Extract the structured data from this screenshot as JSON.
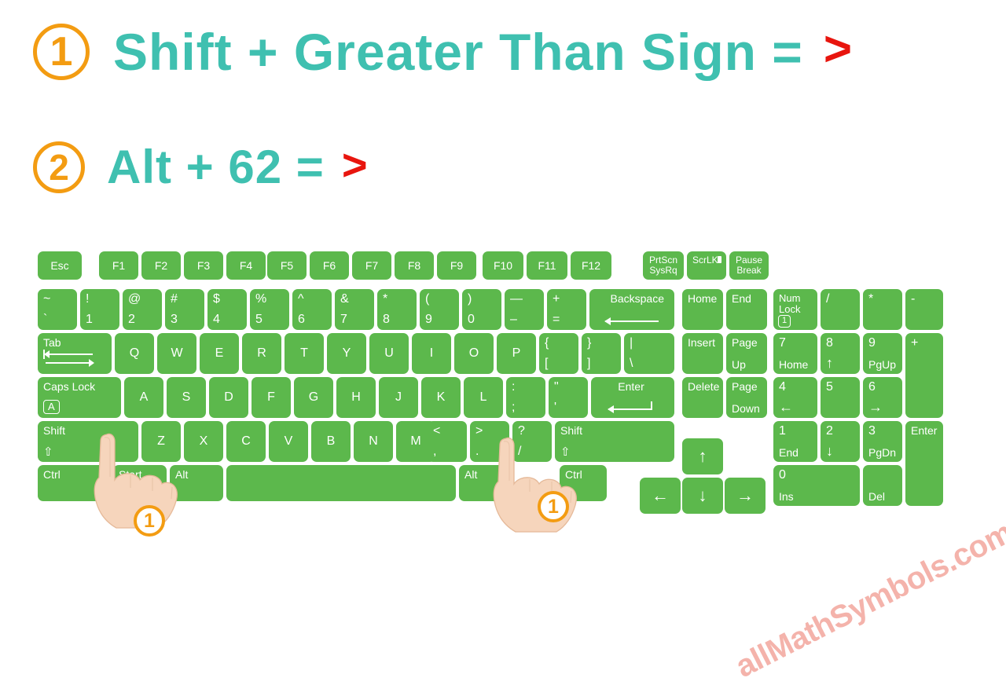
{
  "page": {
    "background": "#ffffff",
    "accent_teal": "#3fc0b0",
    "accent_orange": "#f39c12",
    "accent_red": "#e8150e",
    "key_green": "#5cb84c",
    "watermark_color": "#f4b3ab"
  },
  "instructions": [
    {
      "number": "1",
      "text": "Shift  +  Greater Than Sign  =",
      "result": ">"
    },
    {
      "number": "2",
      "text": "Alt  +  62  =",
      "result": ">"
    }
  ],
  "watermark": {
    "text": "allMathSymbols.com"
  },
  "markers": [
    {
      "label": "1",
      "target": "left-shift"
    },
    {
      "label": "1",
      "target": "greater-than-key"
    }
  ],
  "keyboard": {
    "function_row": [
      {
        "label": "Esc"
      },
      {
        "label": "F1"
      },
      {
        "label": "F2"
      },
      {
        "label": "F3"
      },
      {
        "label": "F4"
      },
      {
        "label": "F5"
      },
      {
        "label": "F6"
      },
      {
        "label": "F7"
      },
      {
        "label": "F8"
      },
      {
        "label": "F9"
      },
      {
        "label": "F10"
      },
      {
        "label": "F11"
      },
      {
        "label": "F12"
      }
    ],
    "function_row_right": [
      {
        "top": "PrtScn",
        "bottom": "SysRq"
      },
      {
        "top": "ScrLK",
        "bottom": ""
      },
      {
        "top": "Pause",
        "bottom": "Break"
      }
    ],
    "number_row": [
      {
        "top": "~",
        "bottom": "`"
      },
      {
        "top": "!",
        "bottom": "1"
      },
      {
        "top": "@",
        "bottom": "2"
      },
      {
        "top": "#",
        "bottom": "3"
      },
      {
        "top": "$",
        "bottom": "4"
      },
      {
        "top": "%",
        "bottom": "5"
      },
      {
        "top": "^",
        "bottom": "6"
      },
      {
        "top": "&",
        "bottom": "7"
      },
      {
        "top": "*",
        "bottom": "8"
      },
      {
        "top": "(",
        "bottom": "9"
      },
      {
        "top": ")",
        "bottom": "0"
      },
      {
        "top": "—",
        "bottom": "–"
      },
      {
        "top": "+",
        "bottom": "="
      }
    ],
    "backspace": {
      "label": "Backspace"
    },
    "tab": {
      "label": "Tab"
    },
    "qwerty_row": [
      {
        "label": "Q"
      },
      {
        "label": "W"
      },
      {
        "label": "E"
      },
      {
        "label": "R"
      },
      {
        "label": "T"
      },
      {
        "label": "Y"
      },
      {
        "label": "U"
      },
      {
        "label": "I"
      },
      {
        "label": "O"
      },
      {
        "label": "P"
      }
    ],
    "qwerty_row_symbols": [
      {
        "top": "{",
        "bottom": "["
      },
      {
        "top": "}",
        "bottom": "]"
      },
      {
        "top": "|",
        "bottom": "\\"
      }
    ],
    "caps_lock": {
      "label": "Caps Lock",
      "indicator": "A"
    },
    "home_row": [
      {
        "label": "A"
      },
      {
        "label": "S"
      },
      {
        "label": "D"
      },
      {
        "label": "F"
      },
      {
        "label": "G"
      },
      {
        "label": "H"
      },
      {
        "label": "J"
      },
      {
        "label": "K"
      },
      {
        "label": "L"
      }
    ],
    "home_row_symbols": [
      {
        "top": ":",
        "bottom": ";"
      },
      {
        "top": "\"",
        "bottom": "'"
      }
    ],
    "enter": {
      "label": "Enter"
    },
    "left_shift": {
      "label": "Shift",
      "glyph": "⇧"
    },
    "bottom_row_letters": [
      {
        "label": "Z"
      },
      {
        "label": "X"
      },
      {
        "label": "C"
      },
      {
        "label": "V"
      },
      {
        "label": "B"
      },
      {
        "label": "N"
      },
      {
        "label": "M"
      }
    ],
    "bottom_row_symbols": [
      {
        "top": "<",
        "bottom": ","
      },
      {
        "top": ">",
        "bottom": "."
      },
      {
        "top": "?",
        "bottom": "/"
      }
    ],
    "right_shift": {
      "label": "Shift",
      "glyph": "⇧"
    },
    "modifier_row": [
      {
        "label": "Ctrl"
      },
      {
        "label": "Start"
      },
      {
        "label": "Alt"
      },
      {
        "label": ""
      },
      {
        "label": "Alt"
      },
      {
        "label": "Ctrl"
      }
    ],
    "nav_cluster": [
      {
        "top": "Home",
        "bottom": ""
      },
      {
        "top": "End",
        "bottom": ""
      },
      {
        "top": "Insert",
        "bottom": ""
      },
      {
        "top": "Page",
        "bottom": "Up"
      },
      {
        "top": "Delete",
        "bottom": ""
      },
      {
        "top": "Page",
        "bottom": "Down"
      }
    ],
    "arrow_keys": [
      {
        "label": "↑",
        "name": "up"
      },
      {
        "label": "←",
        "name": "left"
      },
      {
        "label": "↓",
        "name": "down"
      },
      {
        "label": "→",
        "name": "right"
      }
    ],
    "numpad": {
      "num_lock": {
        "line1": "Num",
        "line2": "Lock",
        "indicator": "1"
      },
      "divide": {
        "label": "/"
      },
      "multiply": {
        "label": "*"
      },
      "minus": {
        "label": "-"
      },
      "plus": {
        "label": "+"
      },
      "enter": {
        "label": "Enter"
      },
      "keys": [
        {
          "top": "7",
          "bottom": "Home"
        },
        {
          "top": "8",
          "bottom": "↑"
        },
        {
          "top": "9",
          "bottom": "PgUp"
        },
        {
          "top": "4",
          "bottom": "←"
        },
        {
          "top": "5",
          "bottom": ""
        },
        {
          "top": "6",
          "bottom": "→"
        },
        {
          "top": "1",
          "bottom": "End"
        },
        {
          "top": "2",
          "bottom": "↓"
        },
        {
          "top": "3",
          "bottom": "PgDn"
        },
        {
          "top": "0",
          "bottom": "Ins"
        },
        {
          "top": "",
          "bottom": "Del"
        }
      ]
    }
  }
}
